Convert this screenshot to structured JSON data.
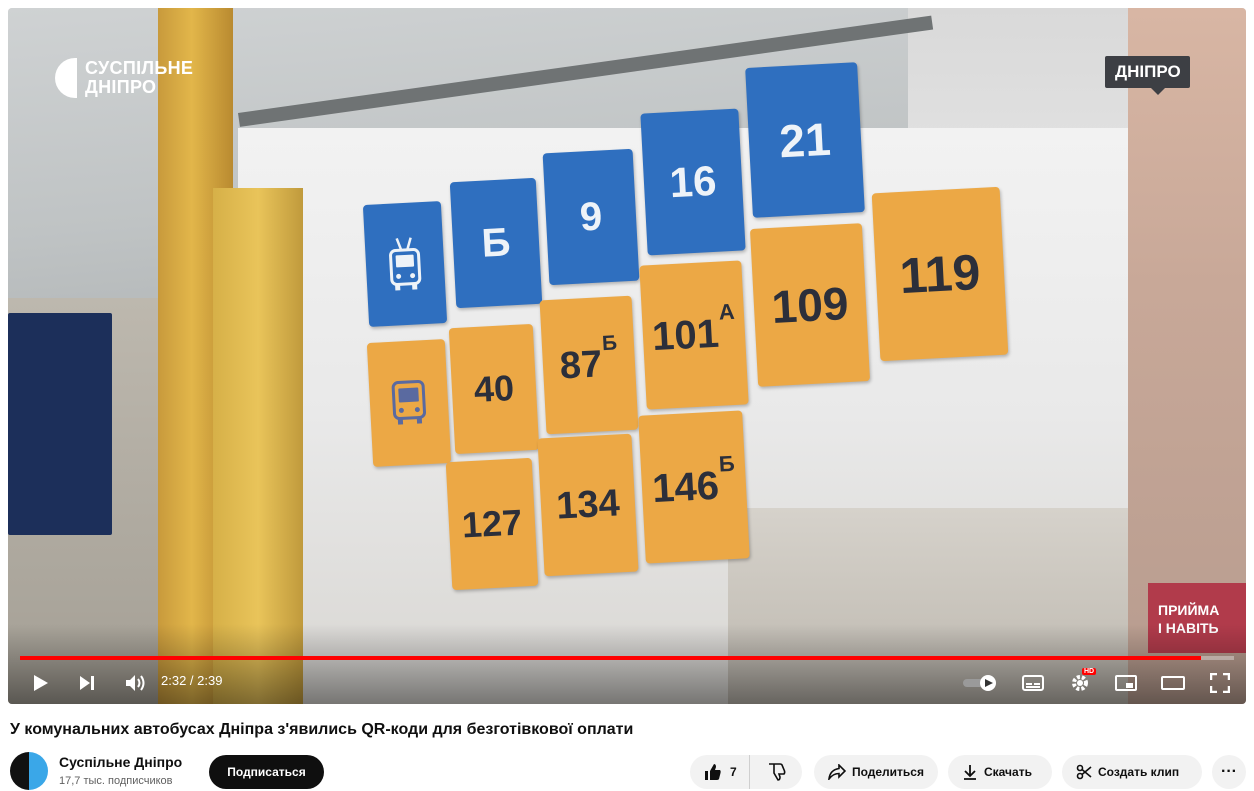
{
  "video": {
    "brand_logo_text": "СУСПІЛЬНЕ\nДНІПРО",
    "city_badge": "ДНІПРО",
    "route_board": {
      "trolleybus": {
        "icon": "trolleybus-icon",
        "routes": [
          {
            "num": "Б",
            "sup": ""
          },
          {
            "num": "9",
            "sup": ""
          },
          {
            "num": "16",
            "sup": ""
          },
          {
            "num": "21",
            "sup": ""
          }
        ]
      },
      "bus": {
        "icon": "bus-icon",
        "routes": [
          {
            "num": "40",
            "sup": ""
          },
          {
            "num": "87",
            "sup": "Б"
          },
          {
            "num": "101",
            "sup": "А"
          },
          {
            "num": "109",
            "sup": ""
          },
          {
            "num": "119",
            "sup": ""
          },
          {
            "num": "127",
            "sup": ""
          },
          {
            "num": "134",
            "sup": ""
          },
          {
            "num": "146",
            "sup": "Б"
          }
        ]
      }
    },
    "background_sign": [
      "ПРИЙМА",
      "І НАВІТЬ"
    ]
  },
  "player": {
    "current_time": "2:32",
    "duration": "2:39",
    "time_display": "2:32 / 2:39",
    "progress": 0.973,
    "icons": {
      "play": "play-icon",
      "next": "next-icon",
      "volume": "volume-icon",
      "autoplay": "autoplay-toggle-icon",
      "subtitles": "subtitles-icon",
      "settings": "settings-icon",
      "miniplayer": "miniplayer-icon",
      "theater": "theater-mode-icon",
      "fullscreen": "fullscreen-icon"
    },
    "settings_badge": "HD",
    "progress_color": "#ff0000"
  },
  "details": {
    "title": "У комунальних автобусах Дніпра з'явились QR-коди для безготівкової оплати",
    "channel_name": "Суспільне Дніпро",
    "subscribers": "17,7 тыс. подписчиков",
    "subscribe_label": "Подписаться",
    "like_count": "7",
    "share_label": "Поделиться",
    "download_label": "Скачать",
    "clip_label": "Создать клип",
    "more_label": "···"
  },
  "colors": {
    "trolleybus_tile": "#2f6fbf",
    "bus_tile": "#eca845",
    "subscribe_bg": "#0f0f0f"
  }
}
